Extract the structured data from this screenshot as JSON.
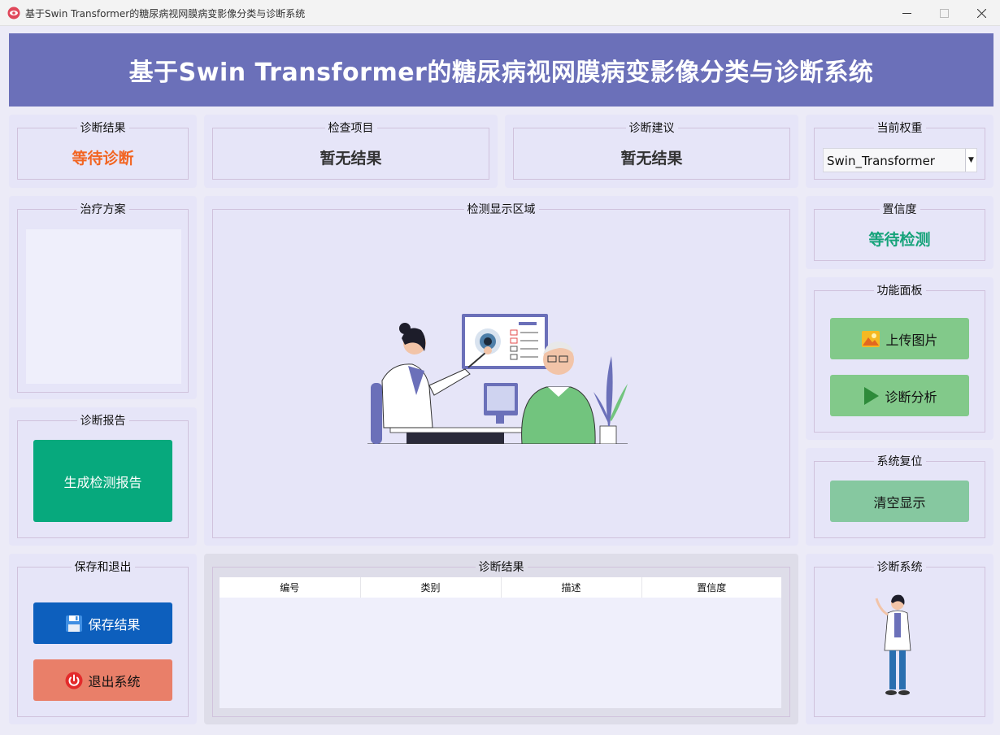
{
  "window": {
    "title": "基于Swin Transformer的糖尿病视网膜病变影像分类与诊断系统"
  },
  "header": {
    "title": "基于Swin Transformer的糖尿病视网膜病变影像分类与诊断系统"
  },
  "diagnosis_result": {
    "title": "诊断结果",
    "value": "等待诊断",
    "color": "#f26522"
  },
  "exam_item": {
    "title": "检查项目",
    "value": "暂无结果"
  },
  "advice": {
    "title": "诊断建议",
    "value": "暂无结果"
  },
  "weights": {
    "title": "当前权重",
    "selected": "Swin_Transformer"
  },
  "treatment": {
    "title": "治疗方案"
  },
  "display": {
    "title": "检测显示区域"
  },
  "confidence": {
    "title": "置信度",
    "value": "等待检测",
    "color": "#16a37a"
  },
  "functions": {
    "title": "功能面板",
    "upload_label": "上传图片",
    "analyze_label": "诊断分析"
  },
  "reset": {
    "title": "系统复位",
    "clear_label": "清空显示"
  },
  "report": {
    "title": "诊断报告",
    "generate_label": "生成检测报告",
    "color": "#07a97d"
  },
  "save_exit": {
    "title": "保存和退出",
    "save_label": "保存结果",
    "exit_label": "退出系统",
    "save_color": "#0d5fbd",
    "exit_color": "#e97f69"
  },
  "results_table": {
    "title": "诊断结果",
    "columns": [
      "编号",
      "类别",
      "描述",
      "置信度"
    ]
  },
  "system": {
    "title": "诊断系统"
  },
  "icons": [
    "eye-app-icon",
    "image-icon",
    "play-icon",
    "save-icon",
    "power-icon"
  ]
}
